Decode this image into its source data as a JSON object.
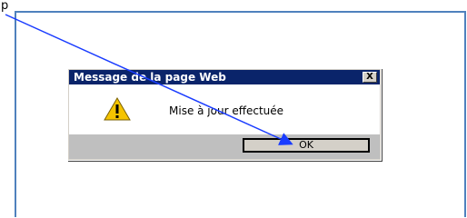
{
  "page": {
    "heading": "p"
  },
  "dialog": {
    "title": "Message de la page Web",
    "close_label": "X",
    "message": "Mise à jour effectuée",
    "ok_label": "OK",
    "icon": "warning-icon"
  },
  "colors": {
    "frame_border": "#4f81bd",
    "titlebar": "#0a246a",
    "arrow": "#1a3cff"
  }
}
